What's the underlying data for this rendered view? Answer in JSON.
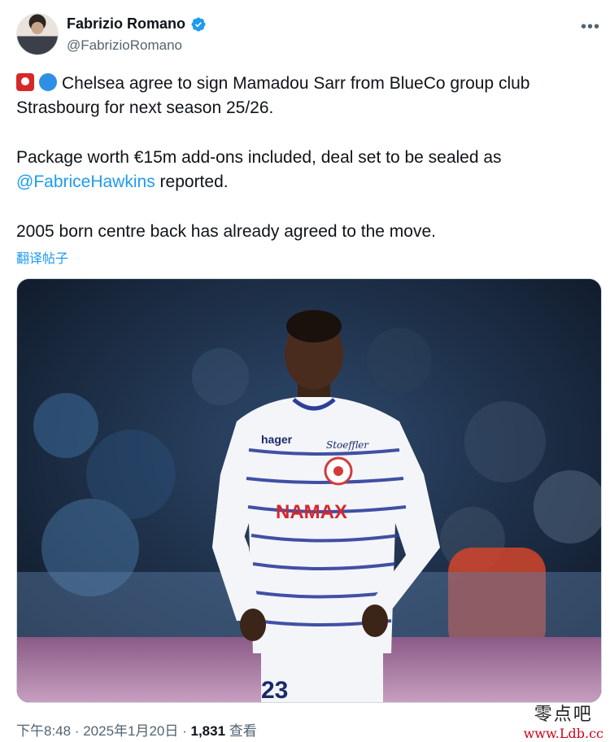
{
  "author": {
    "display_name": "Fabrizio Romano",
    "handle": "@FabrizioRomano",
    "verified_color": "#1d9bf0"
  },
  "tweet": {
    "line1": "Chelsea agree to sign Mamadou Sarr from BlueCo group club Strasbourg for next season 25/26.",
    "line2_before": "Package worth €15m add-ons included, deal set to be sealed as",
    "mention": "@FabriceHawkins",
    "line2_after": " reported.",
    "line3": "2005 born centre back has already agreed to the move.",
    "emojis": [
      "siren-icon",
      "blue-circle-icon"
    ]
  },
  "translate_label": "翻译帖子",
  "media": {
    "jersey_sponsor": "NAMAX",
    "jersey_brand": "hager",
    "jersey_kit": "Stoeffler",
    "jersey_number": "23"
  },
  "meta": {
    "time": "下午8:48",
    "sep1": " · ",
    "date": "2025年1月20日",
    "sep2": " · ",
    "views_count": "1,831",
    "views_label": " 查看"
  },
  "watermark": {
    "title": "零点吧",
    "url": "www.Ldb.cc"
  },
  "colors": {
    "accent": "#1d9bf0",
    "text": "#0f1419",
    "muted": "#536471"
  }
}
